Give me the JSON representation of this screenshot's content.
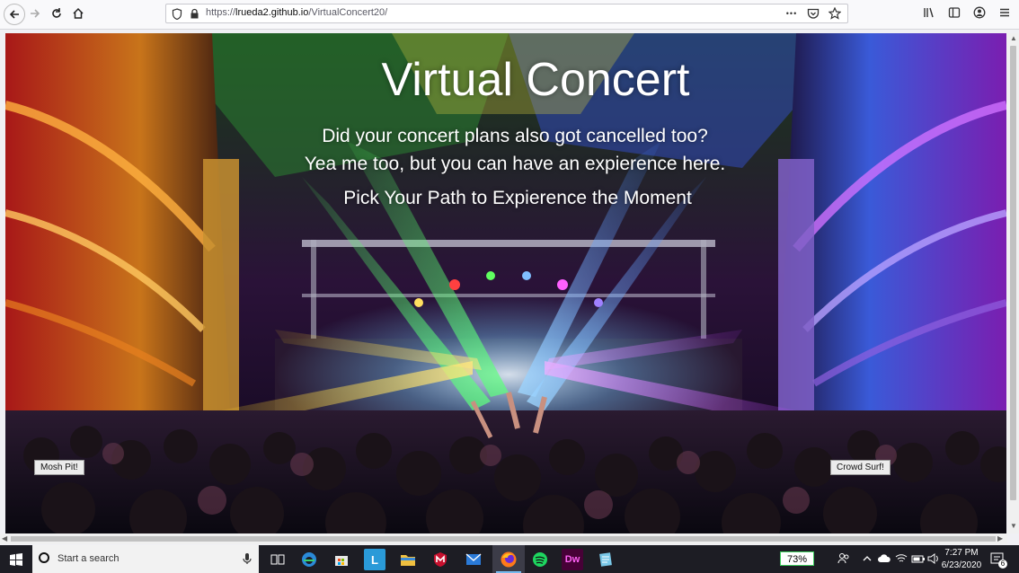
{
  "browser": {
    "url_prefix": "https://",
    "url_host": "lrueda2.github.io",
    "url_path": "/VirtualConcert20/",
    "more_label": "•••"
  },
  "page": {
    "title": "Virtual Concert",
    "subtitle_line1": "Did your concert plans also got cancelled too?",
    "subtitle_line2": "Yea me too, but you can have an expierence here.",
    "subtitle_line3": "Pick Your Path to Expierence the Moment",
    "left_button": "Mosh Pit!",
    "right_button": "Crowd Surf!"
  },
  "taskbar": {
    "search_placeholder": "Start a search",
    "battery": "73%",
    "time": "7:27 PM",
    "date": "6/23/2020",
    "notification_count": "6",
    "apps": [
      "task-view",
      "edge",
      "store",
      "lexicon",
      "file-explorer",
      "mcafee",
      "mail",
      "firefox",
      "spotify",
      "dreamweaver",
      "notepad"
    ]
  },
  "colors": {
    "accent_blue": "#76b9ed",
    "taskbar": "#1d1d24",
    "battery_green": "#3fcf5f"
  }
}
